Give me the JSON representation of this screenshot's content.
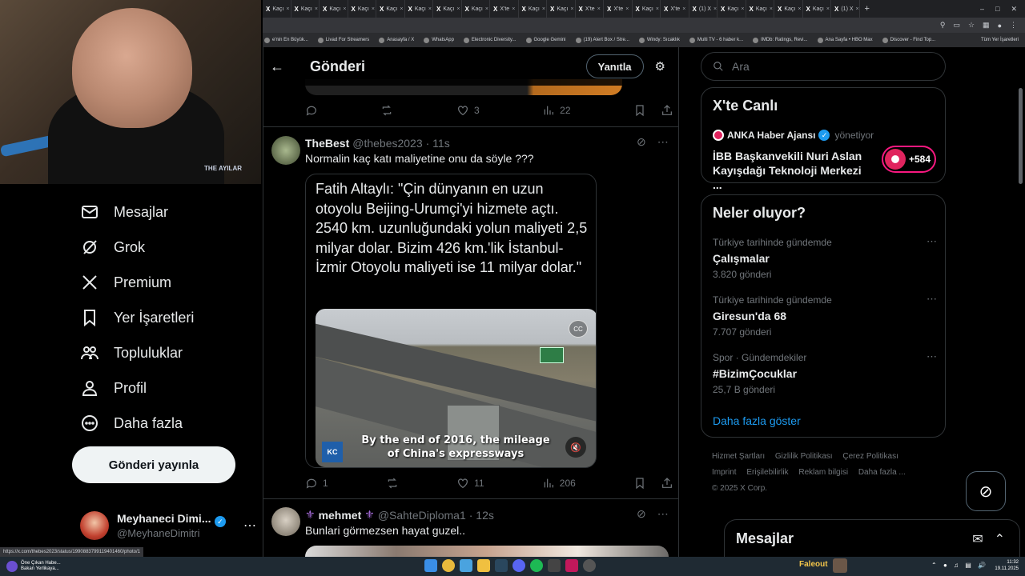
{
  "browser": {
    "tabs": [
      {
        "glyph": "X",
        "label": "Kaçı"
      },
      {
        "glyph": "X",
        "label": "Kaçı"
      },
      {
        "glyph": "X",
        "label": "Kaçı"
      },
      {
        "glyph": "X",
        "label": "Kaçı"
      },
      {
        "glyph": "X",
        "label": "Kaçı"
      },
      {
        "glyph": "X",
        "label": "Kaçı"
      },
      {
        "glyph": "X",
        "label": "Kaçı"
      },
      {
        "glyph": "X",
        "label": "Kaçı"
      },
      {
        "glyph": "X",
        "label": "X'te"
      },
      {
        "glyph": "X",
        "label": "Kaçı"
      },
      {
        "glyph": "X",
        "label": "Kaçı"
      },
      {
        "glyph": "X",
        "label": "X'te"
      },
      {
        "glyph": "X",
        "label": "X'te"
      },
      {
        "glyph": "X",
        "label": "Kaçı"
      },
      {
        "glyph": "X",
        "label": "X'te"
      },
      {
        "glyph": "X",
        "label": "(1) X"
      },
      {
        "glyph": "X",
        "label": "Kaçı"
      },
      {
        "glyph": "X",
        "label": "Kaçı"
      },
      {
        "glyph": "X",
        "label": "Kaçı"
      },
      {
        "glyph": "X",
        "label": "Kaçı"
      },
      {
        "glyph": "X",
        "label": "(1) X"
      }
    ],
    "bookmarks": [
      "e'nin En Büyük...",
      "Livad For Streamers",
      "Anasayfa / X",
      "WhatsApp",
      "Electronic Diversity...",
      "Google Gemini",
      "(19) Alert Box / Stre...",
      "Windy: Sıcaklık",
      "Multi TV - 6 haber k...",
      "IMDb: Ratings, Revi...",
      "Ana Sayfa • HBO Max",
      "Discover - Find Top..."
    ],
    "bookmarks_right": "Tüm Yer İşaretleri",
    "status_url": "https://x.com/thebes2023/status/1990883799119401460/photo/1"
  },
  "sidebar": {
    "items": [
      {
        "label": "Mesajlar",
        "icon": "mail-icon"
      },
      {
        "label": "Grok",
        "icon": "grok-icon"
      },
      {
        "label": "Premium",
        "icon": "x-logo-icon"
      },
      {
        "label": "Yer İşaretleri",
        "icon": "bookmark-icon"
      },
      {
        "label": "Topluluklar",
        "icon": "communities-icon"
      },
      {
        "label": "Profil",
        "icon": "profile-icon"
      },
      {
        "label": "Daha fazla",
        "icon": "more-circle-icon"
      }
    ],
    "post_button": "Gönderi yayınla",
    "account": {
      "name": "Meyhaneci Dimi...",
      "handle": "@MeyhaneDimitri"
    }
  },
  "main": {
    "title": "Gönderi",
    "reply_button": "Yanıtla",
    "prev_actions": {
      "replies": "",
      "reposts": "",
      "likes": "3",
      "views": "22"
    },
    "tweet1": {
      "name": "TheBest",
      "handle": "@thebes2023",
      "time": "· 11s",
      "text": "Normalin kaç katı maliyetine onu da söyle ???",
      "quote": "Fatih Altaylı: \"Çin dünyanın en uzun otoyolu Beijing-Urumçi'yi hizmete açtı. 2540 km. uzunluğundaki yolun maliyeti 2,5 milyar dolar. Bizim 426 km.'lik İstanbul-İzmir Otoyolu maliyeti ise 11 milyar dolar.\"",
      "video_caption_1": "By the end of 2016, the mileage",
      "video_caption_2": "of China's expressways",
      "cc": "CC",
      "actions": {
        "replies": "1",
        "reposts": "",
        "likes": "11",
        "views": "206"
      }
    },
    "tweet2": {
      "name": "mehmet",
      "handle": "@SahteDiploma1",
      "time": "· 12s",
      "text": "Bunlari görmezsen hayat guzel.."
    }
  },
  "right": {
    "search_placeholder": "Ara",
    "live": {
      "title": "X'te Canlı",
      "host": "ANKA Haber Ajansı",
      "role": "yönetiyor",
      "headline": "İBB Başkanvekili Nuri Aslan Kayışdağı Teknoloji Merkezi ...",
      "listeners": "+584"
    },
    "trends": {
      "title": "Neler oluyor?",
      "items": [
        {
          "meta": "Türkiye tarihinde gündemde",
          "name": "Çalışmalar",
          "count": "3.820 gönderi"
        },
        {
          "meta": "Türkiye tarihinde gündemde",
          "name": "Giresun'da 68",
          "count": "7.707 gönderi"
        },
        {
          "meta": "Spor · Gündemdekiler",
          "name": "#BizimÇocuklar",
          "count": "25,7 B gönderi"
        }
      ],
      "show_more": "Daha fazla göster"
    },
    "footer": {
      "links": [
        "Hizmet Şartları",
        "Gizlilik Politikası",
        "Çerez Politikası",
        "Imprint",
        "Erişilebilirlik",
        "Reklam bilgisi",
        "Daha fazla ..."
      ],
      "copyright": "© 2025 X Corp."
    },
    "dm_title": "Mesajlar"
  },
  "webcam": {
    "logo": "THE AYILAR"
  },
  "taskbar": {
    "news_title": "Öne Çıkan Habe...",
    "news_sub": "Bakan Yerlikaya...",
    "user": "Faleout",
    "time": "11:32",
    "date": "19.11.2025"
  },
  "colors": {
    "accent": "#1d9bf0",
    "live": "#f91880",
    "verified": "#1d9bf0",
    "background": "#000000"
  }
}
